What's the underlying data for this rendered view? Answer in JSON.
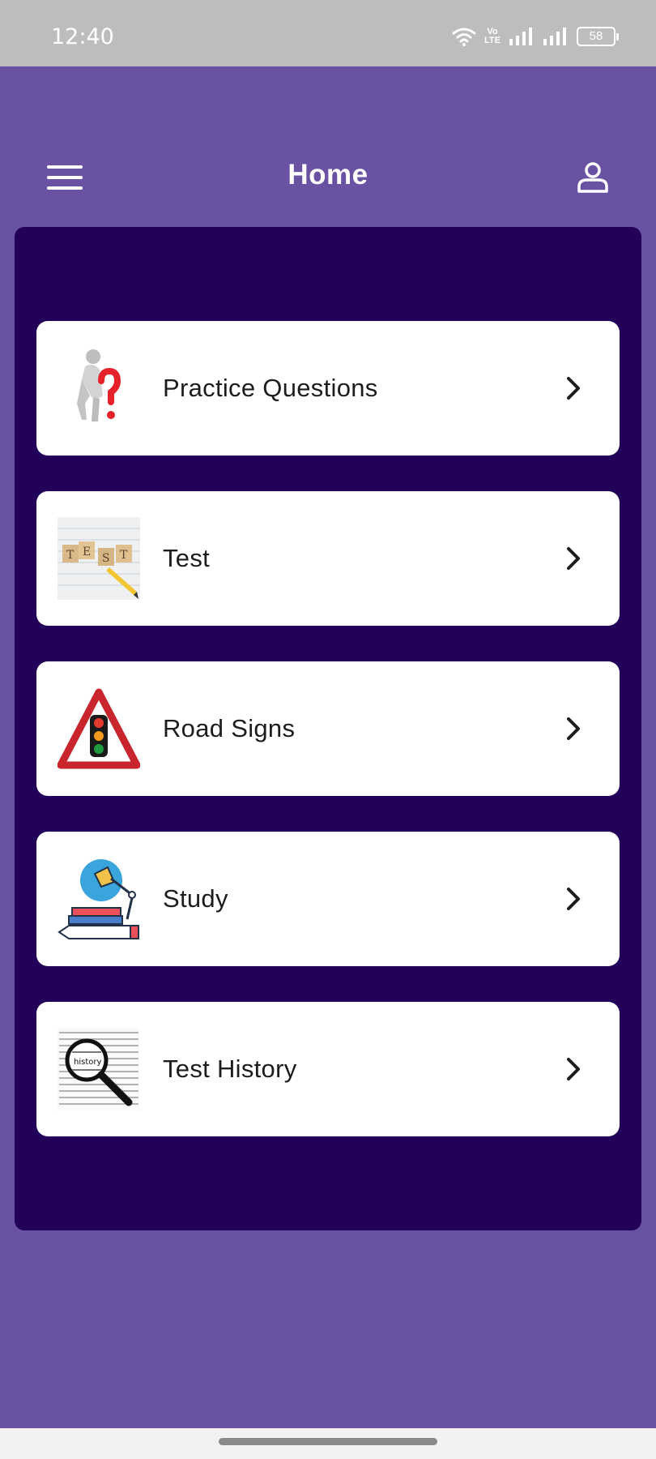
{
  "status_bar": {
    "time": "12:40",
    "volte_top": "Vo",
    "volte_bottom": "LTE",
    "battery": "58",
    "icons": [
      "wifi-icon",
      "signal-icon",
      "signal-icon",
      "battery-icon"
    ]
  },
  "app_bar": {
    "title": "Home",
    "menu_icon": "hamburger-menu-icon",
    "profile_icon": "user-profile-icon"
  },
  "colors": {
    "background": "#6a52a3",
    "panel": "#22005a",
    "card": "#ffffff",
    "status_bar": "#bdbdbd"
  },
  "menu": {
    "items": [
      {
        "label": "Practice Questions",
        "icon": "thinking-figure-question-mark-icon"
      },
      {
        "label": "Test",
        "icon": "test-blocks-pencil-icon"
      },
      {
        "label": "Road Signs",
        "icon": "traffic-light-warning-sign-icon"
      },
      {
        "label": "Study",
        "icon": "desk-lamp-books-icon"
      },
      {
        "label": "Test History",
        "icon": "magnifying-glass-history-icon"
      }
    ]
  }
}
